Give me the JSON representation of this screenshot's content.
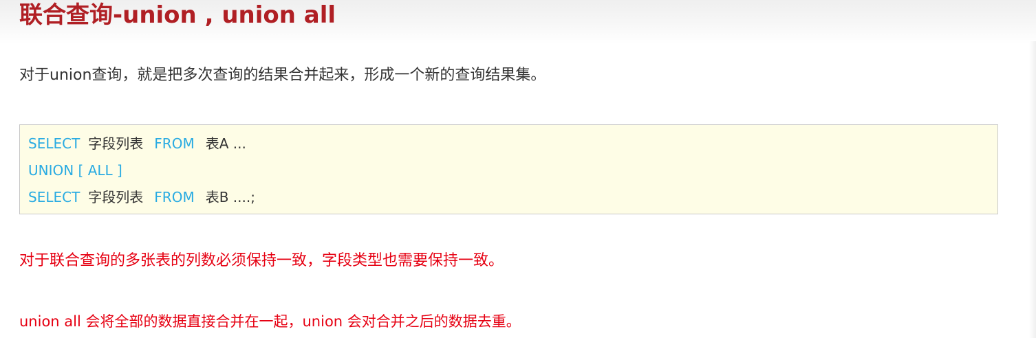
{
  "slide": {
    "title": "联合查询-union , union all",
    "intro": "对于union查询，就是把多次查询的结果合并起来，形成一个新的查询结果集。",
    "code": {
      "line1": {
        "keyword1": "SELECT",
        "text1": "字段列表",
        "keyword2": "FROM",
        "text2": "表A ..."
      },
      "line2": {
        "keyword1": "UNION [ ALL ]"
      },
      "line3": {
        "keyword1": "SELECT",
        "text1": "字段列表",
        "keyword2": "FROM",
        "text2": "表B ....;"
      }
    },
    "note1": "对于联合查询的多张表的列数必须保持一致，字段类型也需要保持一致。",
    "note2": "union all 会将全部的数据直接合并在一起，union 会对合并之后的数据去重。"
  },
  "colors": {
    "title": "#b01f24",
    "keyword": "#29abe2",
    "note": "#e60012",
    "code_background": "#fefde6",
    "body_text": "#333333"
  }
}
